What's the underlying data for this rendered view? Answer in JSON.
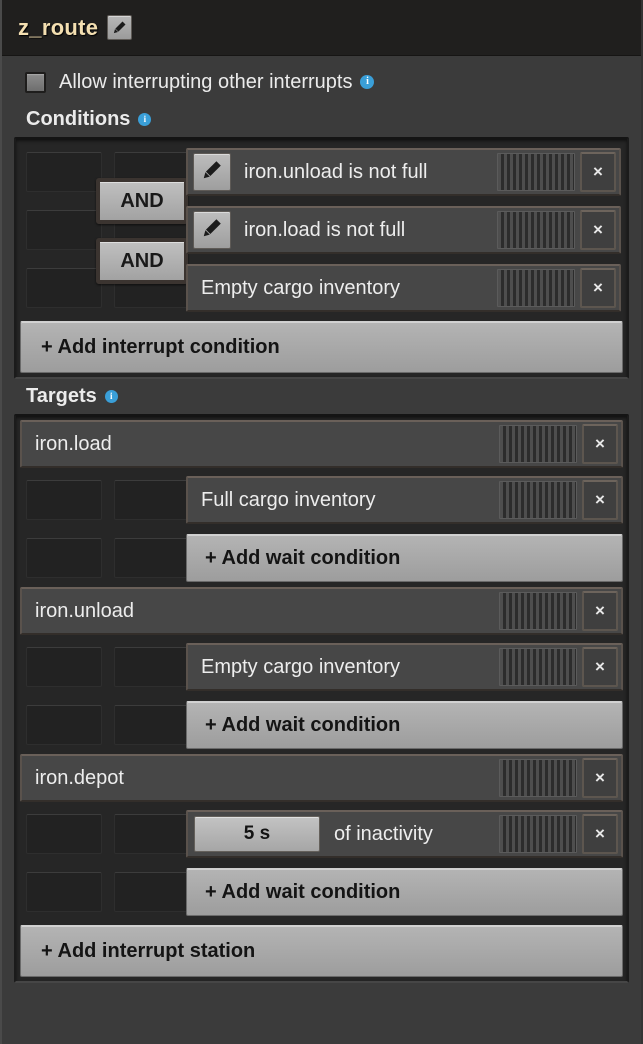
{
  "window": {
    "title": "z_route",
    "edit_icon": "pencil-icon"
  },
  "allow_interrupting": {
    "label": "Allow interrupting other interrupts",
    "checked": false,
    "info_icon": "info-icon"
  },
  "conditions": {
    "heading": "Conditions",
    "info_icon": "info-icon",
    "operators": [
      "AND",
      "AND"
    ],
    "items": [
      {
        "label": "iron.unload is not full",
        "icon": "pencil-icon",
        "has_icon": true,
        "close": "×"
      },
      {
        "label": "iron.load is not full",
        "icon": "pencil-icon",
        "has_icon": true,
        "close": "×"
      },
      {
        "label": "Empty cargo inventory",
        "has_icon": false,
        "close": "×"
      }
    ],
    "add_label": "+ Add interrupt condition"
  },
  "targets": {
    "heading": "Targets",
    "info_icon": "info-icon",
    "add_station_label": "+ Add interrupt station",
    "stations": [
      {
        "name": "iron.load",
        "close": "×",
        "wait_conditions": [
          {
            "label": "Full cargo inventory",
            "type": "text",
            "close": "×"
          }
        ],
        "add_wait_label": "+ Add wait condition"
      },
      {
        "name": "iron.unload",
        "close": "×",
        "wait_conditions": [
          {
            "label": "Empty cargo inventory",
            "type": "text",
            "close": "×"
          }
        ],
        "add_wait_label": "+ Add wait condition"
      },
      {
        "name": "iron.depot",
        "close": "×",
        "wait_conditions": [
          {
            "label": "of inactivity",
            "type": "timer",
            "timer_value": "5 s",
            "close": "×"
          }
        ],
        "add_wait_label": "+ Add wait condition"
      }
    ]
  },
  "colors": {
    "title_text": "#f4dfb1",
    "info_blue": "#3a9fd8",
    "panel_bg": "#262626",
    "window_bg": "#3b3b3b",
    "bar_bg": "#474747",
    "button_light": "#b4b4b4"
  }
}
